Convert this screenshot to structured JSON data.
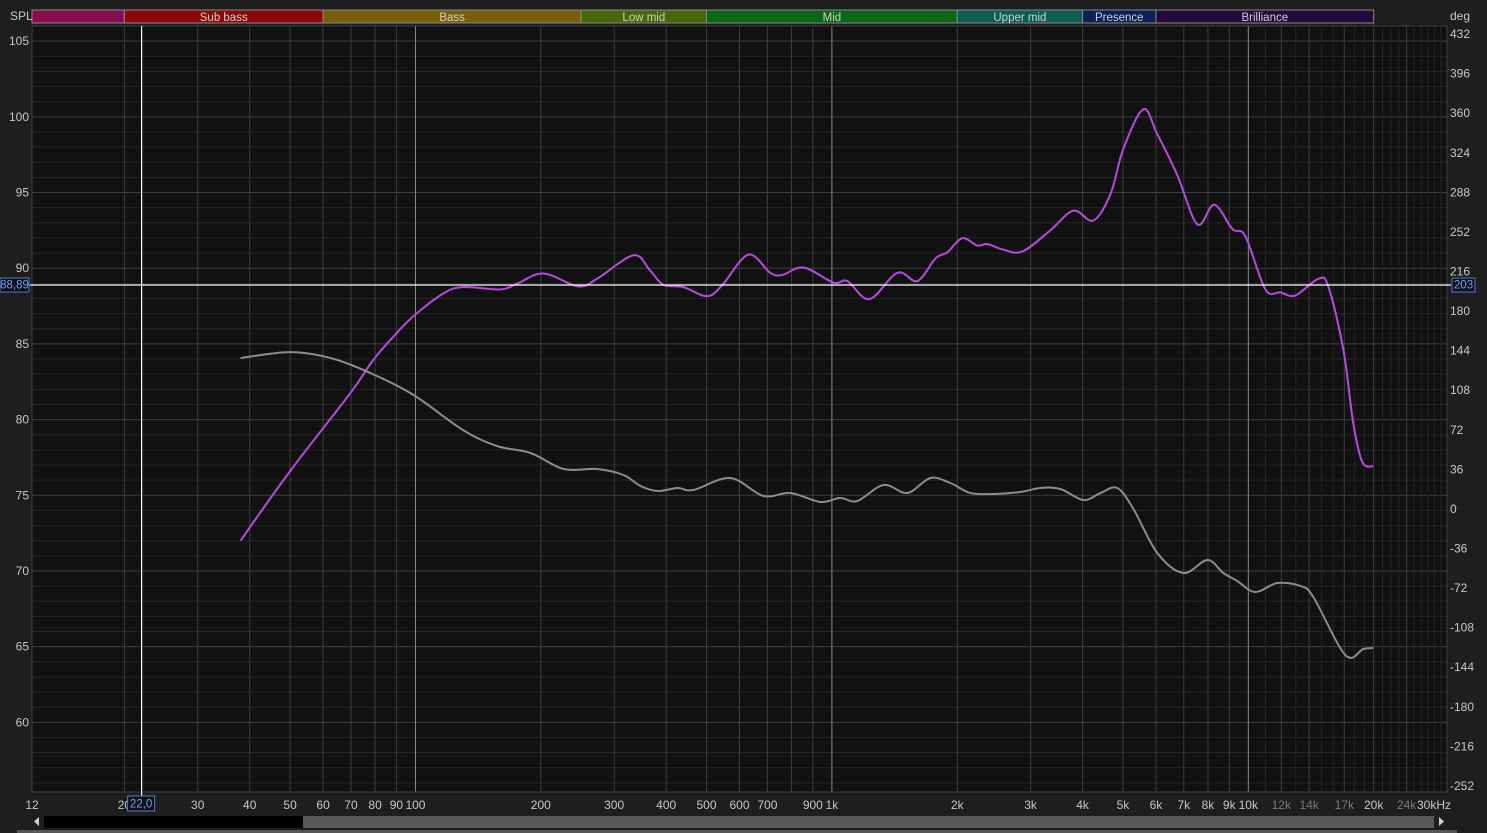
{
  "chart_data": {
    "type": "line",
    "x_scale": "log",
    "xlim": [
      12,
      30000
    ],
    "ylim": [
      55.4,
      106
    ],
    "y2lim": [
      -257.5,
      439.3
    ],
    "ylabel": "SPL",
    "y2label": "deg",
    "x_unit": "kHz",
    "grid": true,
    "x_ticks": [
      {
        "v": 12,
        "label": "12"
      },
      {
        "v": 20,
        "label": "20"
      },
      {
        "v": 30,
        "label": "30"
      },
      {
        "v": 40,
        "label": "40"
      },
      {
        "v": 50,
        "label": "50"
      },
      {
        "v": 60,
        "label": "60"
      },
      {
        "v": 70,
        "label": "70"
      },
      {
        "v": 80,
        "label": "80"
      },
      {
        "v": 90,
        "label": "90"
      },
      {
        "v": 100,
        "label": "100"
      },
      {
        "v": 200,
        "label": "200"
      },
      {
        "v": 300,
        "label": "300"
      },
      {
        "v": 400,
        "label": "400"
      },
      {
        "v": 500,
        "label": "500"
      },
      {
        "v": 600,
        "label": "600"
      },
      {
        "v": 700,
        "label": "700"
      },
      {
        "v": 900,
        "label": "900"
      },
      {
        "v": 1000,
        "label": "1k"
      },
      {
        "v": 2000,
        "label": "2k"
      },
      {
        "v": 3000,
        "label": "3k"
      },
      {
        "v": 4000,
        "label": "4k"
      },
      {
        "v": 5000,
        "label": "5k"
      },
      {
        "v": 6000,
        "label": "6k"
      },
      {
        "v": 7000,
        "label": "7k"
      },
      {
        "v": 8000,
        "label": "8k"
      },
      {
        "v": 9000,
        "label": "9k"
      },
      {
        "v": 10000,
        "label": "10k"
      },
      {
        "v": 12000,
        "label": "12k",
        "dim": true
      },
      {
        "v": 14000,
        "label": "14k",
        "dim": true
      },
      {
        "v": 17000,
        "label": "17k",
        "dim": true
      },
      {
        "v": 20000,
        "label": "20k"
      },
      {
        "v": 24000,
        "label": "24k",
        "dim": true
      },
      {
        "v": 30000,
        "label": "30kHz"
      }
    ],
    "y_ticks": [
      105,
      100,
      95,
      90,
      85,
      80,
      75,
      70,
      65,
      60
    ],
    "y2_ticks": [
      432,
      396,
      360,
      324,
      288,
      252,
      216,
      180,
      144,
      108,
      72,
      36,
      0,
      -36,
      -72,
      -108,
      -144,
      -180,
      -216,
      -252
    ],
    "bands": [
      {
        "name": "",
        "from": 12,
        "to": 20,
        "color": "#8a0e4e"
      },
      {
        "name": "Sub bass",
        "from": 20,
        "to": 60,
        "color": "#8a0808"
      },
      {
        "name": "Bass",
        "from": 60,
        "to": 250,
        "color": "#7a5f08"
      },
      {
        "name": "Low mid",
        "from": 250,
        "to": 500,
        "color": "#456808"
      },
      {
        "name": "Mid",
        "from": 500,
        "to": 2000,
        "color": "#0b6618"
      },
      {
        "name": "Upper mid",
        "from": 2000,
        "to": 4000,
        "color": "#0c5e55"
      },
      {
        "name": "Presence",
        "from": 4000,
        "to": 6000,
        "color": "#0c2058"
      },
      {
        "name": "Brilliance",
        "from": 6000,
        "to": 20000,
        "color": "#240a3c"
      }
    ],
    "series": [
      {
        "axis": "left",
        "color": "#b84ae0",
        "x": [
          38,
          50,
          70,
          79,
          90,
          100,
          117,
          130,
          160,
          176,
          203,
          246,
          273,
          334,
          366,
          394,
          440,
          502,
          546,
          630,
          711,
          760,
          855,
          1008,
          1090,
          1230,
          1436,
          1604,
          1773,
          1893,
          2057,
          2235,
          2360,
          2566,
          2865,
          3346,
          3800,
          4246,
          4666,
          5012,
          5598,
          6046,
          6753,
          7544,
          8281,
          9156,
          9840,
          10990,
          11940,
          12970,
          14730,
          15560,
          16910,
          17870,
          18780,
          19950
        ],
        "y": [
          72.0,
          76.6,
          81.8,
          83.9,
          85.7,
          86.95,
          88.35,
          88.75,
          88.6,
          89.0,
          89.65,
          88.8,
          89.3,
          90.85,
          89.85,
          88.9,
          88.75,
          88.15,
          88.9,
          90.9,
          89.7,
          89.55,
          90.05,
          89.05,
          89.15,
          87.95,
          89.7,
          89.15,
          90.65,
          91.05,
          91.98,
          91.5,
          91.6,
          91.25,
          91.1,
          92.5,
          93.8,
          93.15,
          94.9,
          97.9,
          100.5,
          98.85,
          96.15,
          92.9,
          94.2,
          92.6,
          92.1,
          88.6,
          88.4,
          88.2,
          89.3,
          88.8,
          84.65,
          79.75,
          77.2,
          76.9
        ]
      },
      {
        "axis": "right",
        "color": "#8c8c8c",
        "x": [
          38,
          50,
          62.5,
          78,
          99,
          130,
          157,
          189,
          227,
          273,
          316,
          347,
          381,
          426,
          465,
          570,
          685,
          795,
          938,
          1047,
          1151,
          1330,
          1518,
          1724,
          1925,
          2150,
          2443,
          2836,
          3167,
          3538,
          4018,
          4416,
          4847,
          5296,
          6046,
          6980,
          7973,
          8710,
          9410,
          10390,
          11740,
          13330,
          14320,
          17100,
          18890,
          19950
        ],
        "y": [
          137.3,
          142.7,
          137.3,
          123.6,
          103.6,
          71.8,
          57.2,
          50.9,
          36.3,
          36.3,
          30.9,
          20.9,
          16.3,
          19.0,
          17.2,
          28.1,
          11.8,
          14.5,
          6.3,
          9.9,
          7.2,
          21.8,
          14.5,
          28.1,
          23.6,
          14.5,
          13.6,
          15.4,
          19.0,
          18.1,
          8.1,
          14.5,
          19.0,
          0,
          -40.1,
          -58.3,
          -46.5,
          -58.3,
          -65.6,
          -75.6,
          -67.4,
          -70.1,
          -80.1,
          -132.9,
          -127.4,
          -126.5
        ]
      }
    ],
    "cursor": {
      "x_label": "22,0",
      "x": 22.0,
      "y_label": "88,89",
      "y": 88.89,
      "y2_label": "203",
      "y2": 203
    }
  },
  "colors": {
    "background": "#1e1e1e",
    "plot": "#111111",
    "cursor": "#ffffff",
    "readout": "#6fa0ff"
  }
}
